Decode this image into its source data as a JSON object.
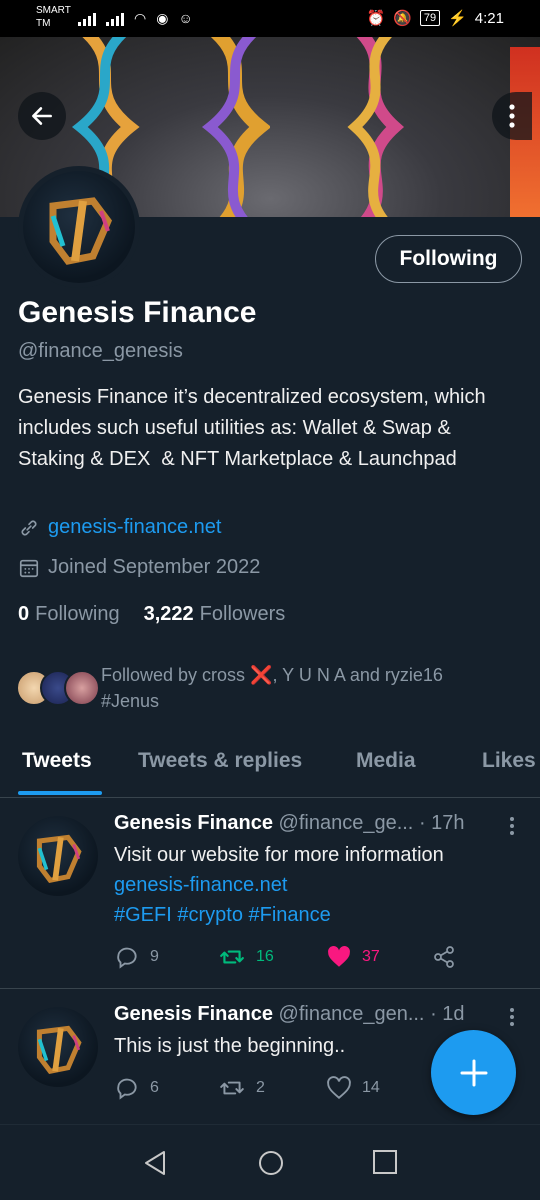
{
  "status_bar": {
    "carrier": "SMART TM",
    "battery": "79",
    "time": "4:21"
  },
  "profile": {
    "name": "Genesis Finance",
    "handle": "@finance_genesis",
    "follow_button": "Following",
    "bio": "Genesis Finance it’s decentralized ecosystem, which includes such useful utilities as: Wallet & Swap & Staking & DEX  & NFT Marketplace & Launchpad",
    "website": "genesis-finance.net",
    "joined": "Joined September 2022",
    "following_count": "0",
    "following_label": "Following",
    "followers_count": "3,222",
    "followers_label": "Followers",
    "followed_by_prefix": "Followed by cross ",
    "followed_by_mark": "❌",
    "followed_by_suffix": ", Y U N A and ryzie16",
    "followed_by_line2": "#Jenus"
  },
  "tabs": [
    "Tweets",
    "Tweets & replies",
    "Media",
    "Likes"
  ],
  "tweets": [
    {
      "name": "Genesis Finance",
      "handle": "@finance_ge...",
      "time": "· 17h",
      "text": "Visit our website for more information",
      "link": "genesis-finance.net",
      "tags": "#GEFI #crypto #Finance",
      "replies": "9",
      "retweets": "16",
      "likes": "37"
    },
    {
      "name": "Genesis Finance",
      "handle": "@finance_gen...",
      "time": "· 1d",
      "text": "This is just the beginning..",
      "replies": "6",
      "retweets": "2",
      "likes": "14"
    }
  ],
  "colors": {
    "background": "#15202b",
    "accent": "#1d9bf0",
    "retweet_active": "#00ba7c",
    "like_active": "#f91880",
    "muted": "#8b98a5"
  },
  "icons": [
    "back-arrow-icon",
    "more-vertical-icon",
    "link-icon",
    "calendar-icon",
    "reply-icon",
    "retweet-icon",
    "heart-icon",
    "share-icon",
    "compose-plus-icon",
    "nav-back-icon",
    "nav-home-icon",
    "nav-recents-icon"
  ]
}
